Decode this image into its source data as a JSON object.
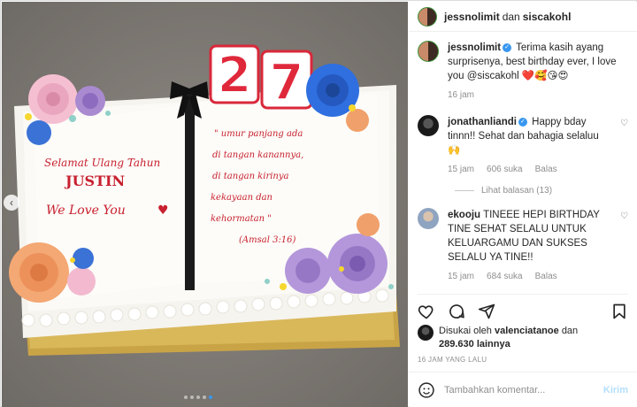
{
  "header": {
    "username": "jessnolimit",
    "conjunction": "dan",
    "collaborator": "siscakohl"
  },
  "caption": {
    "username": "jessnolimit",
    "text": "Terima kasih ayang surprisenya, best birthday ever, I love you @siscakohl",
    "emoji": "❤️🥰😘😍",
    "time": "16 jam"
  },
  "comments": [
    {
      "username": "jonathanliandi",
      "text": "Happy bday tinnn!! Sehat dan bahagia selaluu",
      "emoji": "🙌",
      "time": "15 jam",
      "likes": "606 suka",
      "reply": "Balas",
      "view_replies": "Lihat balasan (13)"
    },
    {
      "username": "ekooju",
      "text": "TINEEE HEPI BIRTHDAY TINE SEHAT SELALU UNTUK KELUARGAMU DAN SUKSES SELALU YA TINE!!",
      "time": "15 jam",
      "likes": "684 suka",
      "reply": "Balas"
    }
  ],
  "likes": {
    "prefix": "Disukai oleh",
    "user": "valenciatanoe",
    "and": "dan",
    "count": "289.630",
    "suffix": "lainnya"
  },
  "time_ago": "16 JAM YANG LALU",
  "composer": {
    "placeholder": "Tambahkan komentar...",
    "post_label": "Kirim"
  },
  "cake": {
    "candles": "27",
    "left_page": [
      "Selamat Ulang Tahun",
      "JUSTIN",
      "We Love You"
    ],
    "right_page": [
      "\" umur panjang ada",
      "di tangan kanannya,",
      "di tangan kirinya",
      "kekayaan dan",
      "kehormatan \"",
      "(Amsal 3:16)"
    ]
  },
  "carousel": {
    "total": 5,
    "active": 5
  }
}
